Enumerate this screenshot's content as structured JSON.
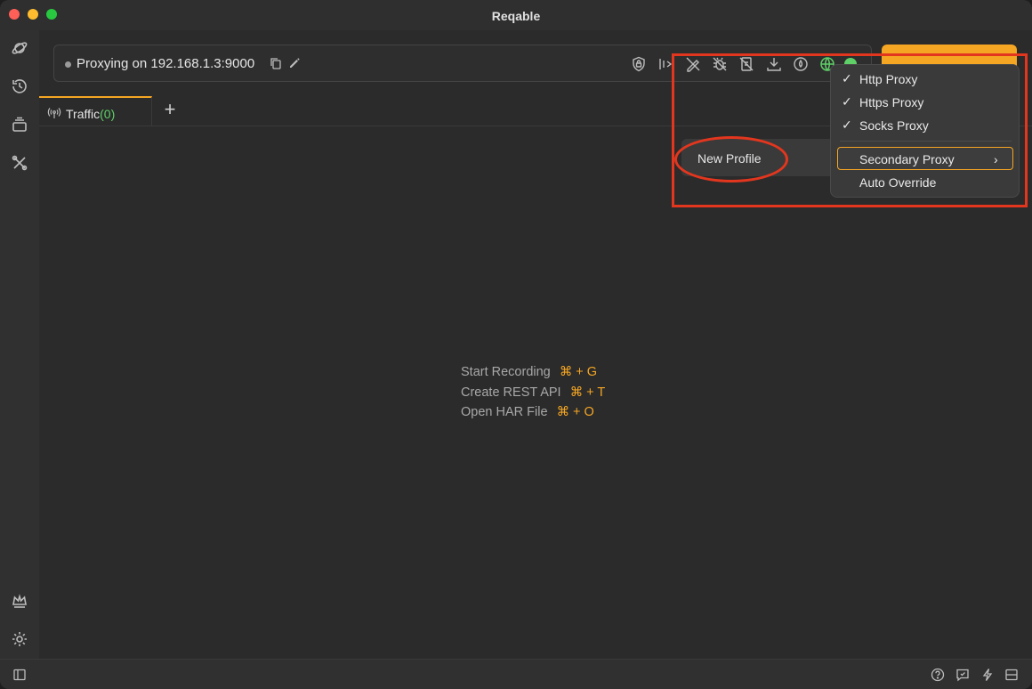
{
  "window": {
    "title": "Reqable"
  },
  "proxy": {
    "status_text": "Proxying on 192.168.1.3:9000"
  },
  "tabs": [
    {
      "label": "Traffic",
      "count": "(0)"
    }
  ],
  "hints": [
    {
      "label": "Start Recording",
      "shortcut": "⌘ + G"
    },
    {
      "label": "Create REST API",
      "shortcut": "⌘ + T"
    },
    {
      "label": "Open HAR File",
      "shortcut": "⌘ + O"
    }
  ],
  "profile_menu": {
    "new_profile": "New Profile"
  },
  "submenu": {
    "items": [
      {
        "label": "Http Proxy",
        "checked": "✓"
      },
      {
        "label": "Https Proxy",
        "checked": "✓"
      },
      {
        "label": "Socks Proxy",
        "checked": "✓"
      }
    ],
    "secondary": "Secondary Proxy",
    "auto_override": "Auto Override",
    "chevron": "›"
  },
  "colors": {
    "accent": "#f5a623",
    "highlight_red": "#e3361e",
    "count_green": "#5fd068"
  }
}
